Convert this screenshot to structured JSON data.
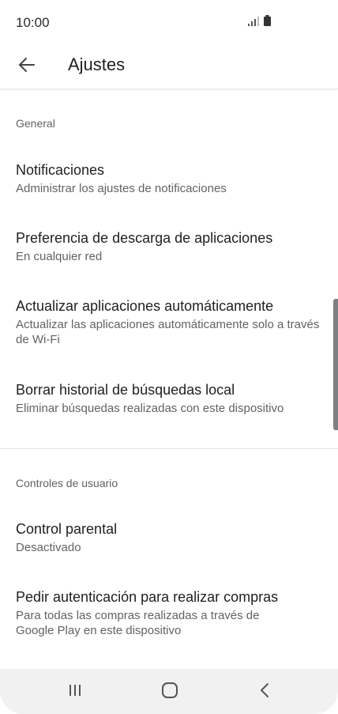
{
  "status_bar": {
    "time": "10:00",
    "icons": [
      "signal-icon",
      "battery-icon"
    ]
  },
  "app_bar": {
    "back_icon": "arrow-back-icon",
    "title": "Ajustes"
  },
  "sections": {
    "general": {
      "header": "General",
      "items": [
        {
          "title": "Notificaciones",
          "subtitle": "Administrar los ajustes de notificaciones"
        },
        {
          "title": "Preferencia de descarga de aplicaciones",
          "subtitle": "En cualquier red"
        },
        {
          "title": "Actualizar aplicaciones automáticamente",
          "subtitle": "Actualizar las aplicaciones automáticamente solo a través de Wi-Fi"
        },
        {
          "title": "Borrar historial de búsquedas local",
          "subtitle": "Eliminar búsquedas realizadas con este dispositivo"
        }
      ]
    },
    "user_controls": {
      "header": "Controles de usuario",
      "items": [
        {
          "title": "Control parental",
          "subtitle": "Desactivado"
        },
        {
          "title": "Pedir autenticación para realizar compras",
          "subtitle": "Para todas las compras realizadas a través de Google Play en este dispositivo"
        }
      ]
    }
  },
  "nav_bar": {
    "buttons": [
      "recent-apps-icon",
      "home-icon",
      "back-icon"
    ]
  },
  "colors": {
    "text_primary": "#202124",
    "text_secondary": "#5f6368",
    "nav_background": "#f1f1f1",
    "scrollbar": "#7d7f85"
  }
}
